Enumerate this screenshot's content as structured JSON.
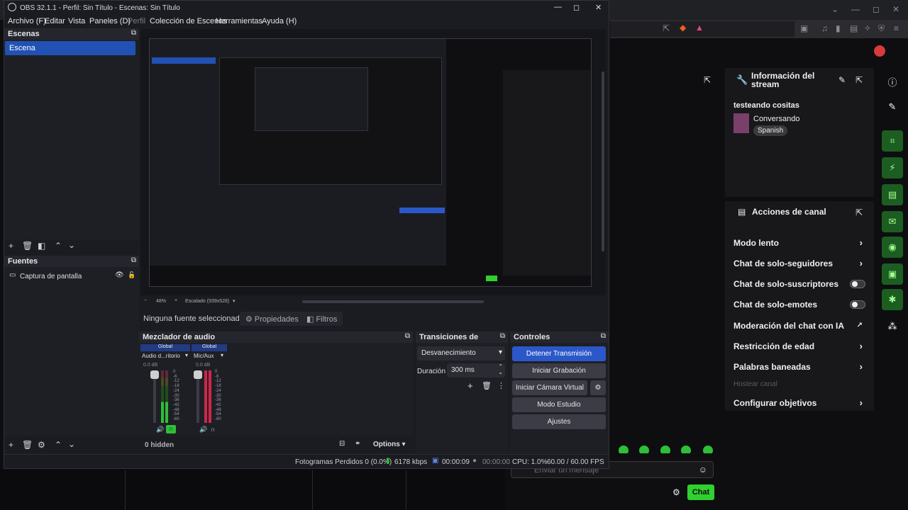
{
  "obs": {
    "title": "OBS 32.1.1 - Perfil: Sin Título - Escenas: Sin Título",
    "menu": [
      "Archivo (F)",
      "Editar",
      "Vista",
      "Paneles (D)",
      "Perfil",
      "Colección de Escenas",
      "Herramientas",
      "Ayuda (H)"
    ],
    "scenes": {
      "title": "Escenas",
      "items": [
        "Escena"
      ]
    },
    "sources": {
      "title": "Fuentes",
      "items": [
        "Captura de pantalla"
      ]
    },
    "preview_bar": {
      "zoom": "48%",
      "scale": "Escalado (939x528)"
    },
    "properties_bar": {
      "no_source": "Ninguna fuente seleccionad",
      "properties": "Propiedades",
      "filters": "Filtros"
    },
    "mixer": {
      "title": "Mezclador de audio",
      "channels": [
        {
          "tag": "Global",
          "name": "Audio d...ritorio",
          "level": "0.0 dB"
        },
        {
          "tag": "Global",
          "name": "Mic/Aux",
          "level": "0.0 dB"
        }
      ],
      "scale": [
        "0",
        "-6",
        "-12",
        "-18",
        "-24",
        "-30",
        "-36",
        "-42",
        "-48",
        "-54",
        "-60"
      ],
      "hidden": "0 hidden",
      "options": "Options"
    },
    "transitions": {
      "title": "Transiciones de escena",
      "selected": "Desvanecimiento",
      "duration_label": "Duración",
      "duration": "300 ms"
    },
    "controls": {
      "title": "Controles",
      "stop_stream": "Detener Transmisión",
      "start_recording": "Iniciar Grabación",
      "virtual_cam": "Iniciar Cámara Virtual",
      "studio_mode": "Modo Estudio",
      "settings": "Ajustes"
    },
    "status": {
      "dropped": "Fotogramas Perdidos 0 (0.0%)",
      "bitrate": "6178 kbps",
      "stream_time": "00:00:09",
      "rec_time": "00:00:00",
      "cpu": "CPU: 1.0%",
      "fps": "60.00 / 60.00 FPS"
    }
  },
  "twitch": {
    "info_panel": {
      "title": "Información del stream",
      "stream_title": "testeando cositas",
      "category": "Conversando",
      "tag": "Spanish"
    },
    "actions_panel": {
      "title": "Acciones de canal",
      "rows": [
        {
          "label": "Modo lento",
          "control": "chevron"
        },
        {
          "label": "Chat de solo-seguidores",
          "control": "chevron"
        },
        {
          "label": "Chat de solo-suscriptores",
          "control": "toggle"
        },
        {
          "label": "Chat de solo-emotes",
          "control": "toggle"
        },
        {
          "label": "Moderación del chat con IA",
          "control": "external"
        },
        {
          "label": "Restricción de edad",
          "control": "chevron"
        },
        {
          "label": "Palabras baneadas",
          "control": "chevron"
        },
        {
          "label": "Hostear canal",
          "control": "disabled"
        },
        {
          "label": "Configurar objetivos",
          "control": "chevron"
        }
      ]
    },
    "chat": {
      "placeholder": "Enviar un mensaje",
      "send": "Chat"
    }
  },
  "colors": {
    "obs_bg": "#1b1c21",
    "obs_accent": "#2b58c9",
    "twitch_bg": "#0e0e10",
    "twitch_green": "#2fd02f"
  }
}
